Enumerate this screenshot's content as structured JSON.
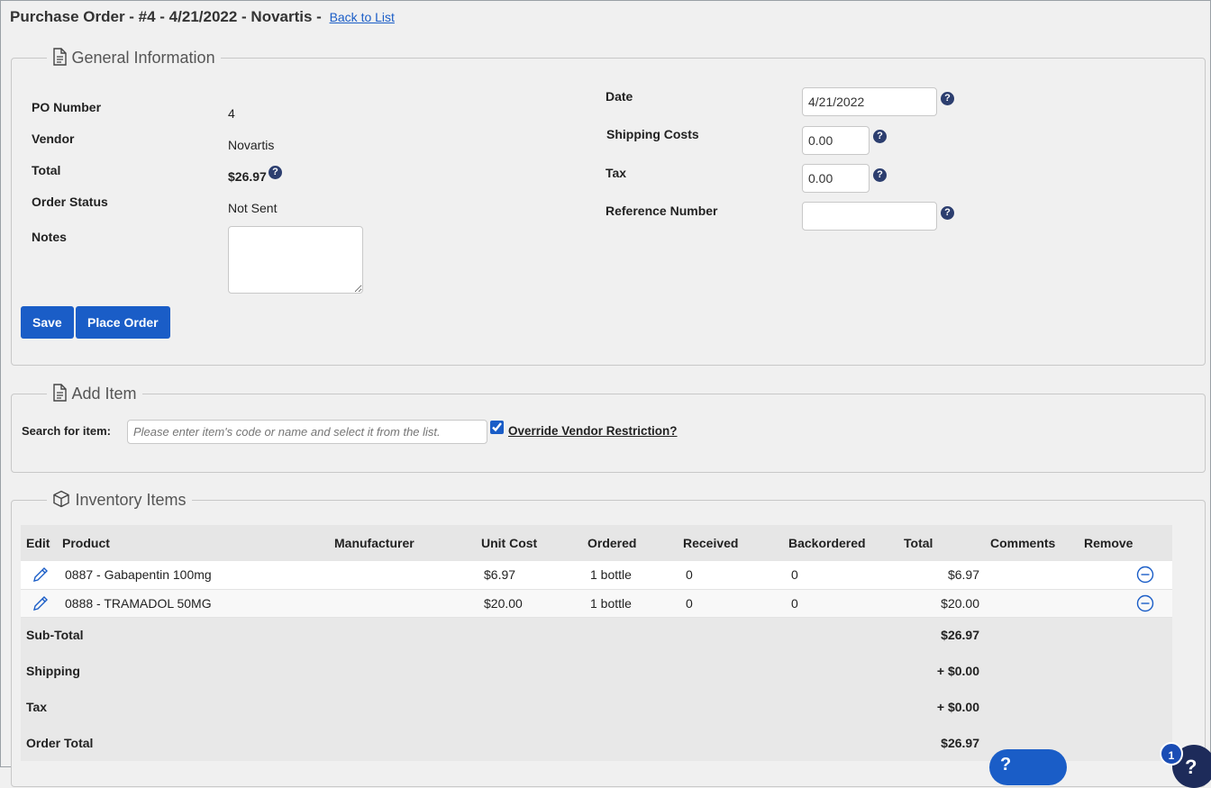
{
  "header": {
    "title": "Purchase Order - #4 - 4/21/2022 - Novartis -",
    "back_link": "Back to List"
  },
  "general": {
    "legend": "General Information",
    "po_number_label": "PO Number",
    "po_number": "4",
    "vendor_label": "Vendor",
    "vendor": "Novartis",
    "total_label": "Total",
    "total": "$26.97",
    "status_label": "Order Status",
    "status": "Not Sent",
    "notes_label": "Notes",
    "notes": "",
    "date_label": "Date",
    "date": "4/21/2022",
    "shipping_label": "Shipping Costs",
    "shipping": "0.00",
    "tax_label": "Tax",
    "tax": "0.00",
    "ref_label": "Reference Number",
    "ref": "",
    "save_label": "Save",
    "place_order_label": "Place Order"
  },
  "add_item": {
    "legend": "Add Item",
    "search_label": "Search for item:",
    "search_placeholder": "Please enter item's code or name and select it from the list.",
    "override_label": "Override Vendor Restriction?",
    "override_checked": true
  },
  "inventory": {
    "legend": "Inventory Items",
    "columns": [
      "Edit",
      "Product",
      "Manufacturer",
      "Unit Cost",
      "Ordered",
      "Received",
      "Backordered",
      "Total",
      "Comments",
      "Remove"
    ],
    "rows": [
      {
        "product": "0887 - Gabapentin 100mg",
        "manufacturer": "",
        "unit_cost": "$6.97",
        "ordered": "1 bottle",
        "received": "0",
        "backordered": "0",
        "total": "$6.97",
        "comments": ""
      },
      {
        "product": "0888 - TRAMADOL 50MG",
        "manufacturer": "",
        "unit_cost": "$20.00",
        "ordered": "1 bottle",
        "received": "0",
        "backordered": "0",
        "total": "$20.00",
        "comments": ""
      }
    ],
    "summary": [
      {
        "label": "Sub-Total",
        "value": "$26.97"
      },
      {
        "label": "Shipping",
        "value": "+ $0.00"
      },
      {
        "label": "Tax",
        "value": "+ $0.00"
      },
      {
        "label": "Order Total",
        "value": "$26.97"
      }
    ]
  },
  "widgets": {
    "notification_count": "1"
  }
}
